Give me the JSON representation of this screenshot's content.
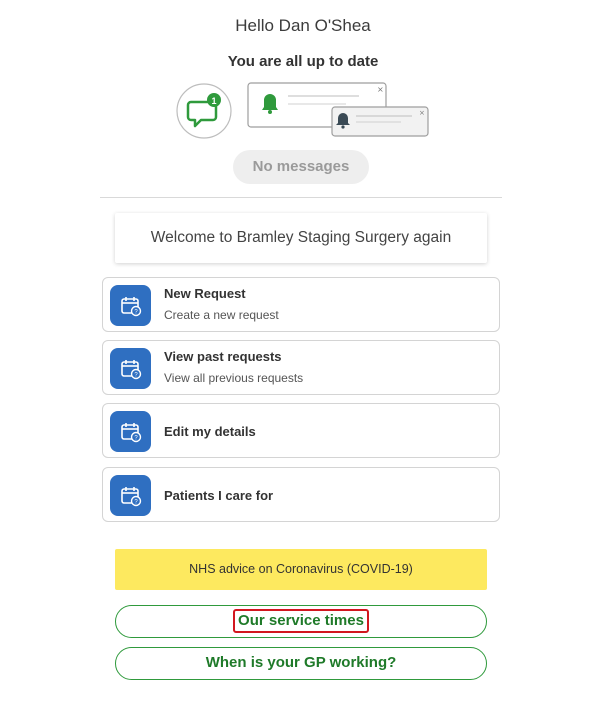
{
  "greeting": "Hello Dan O'Shea",
  "status": {
    "heading": "You are all up to date",
    "badge_count": "1",
    "no_messages_label": "No messages"
  },
  "welcome_text": "Welcome to Bramley Staging Surgery again",
  "menu": [
    {
      "title": "New Request",
      "subtitle": "Create a new request",
      "icon": "calendar-icon"
    },
    {
      "title": "View past requests",
      "subtitle": "View all previous requests",
      "icon": "calendar-icon"
    },
    {
      "title": "Edit my details",
      "subtitle": "",
      "icon": "calendar-icon"
    },
    {
      "title": "Patients I care for",
      "subtitle": "",
      "icon": "calendar-icon"
    }
  ],
  "covid_advice": "NHS advice on Coronavirus (COVID-19)",
  "links": {
    "service_times": "Our service times",
    "gp_working": "When is your GP working?"
  },
  "colors": {
    "brand_blue": "#2f6fc1",
    "green": "#2f9a3c",
    "covid_yellow": "#fde95f",
    "highlight_red": "#d2171f"
  }
}
